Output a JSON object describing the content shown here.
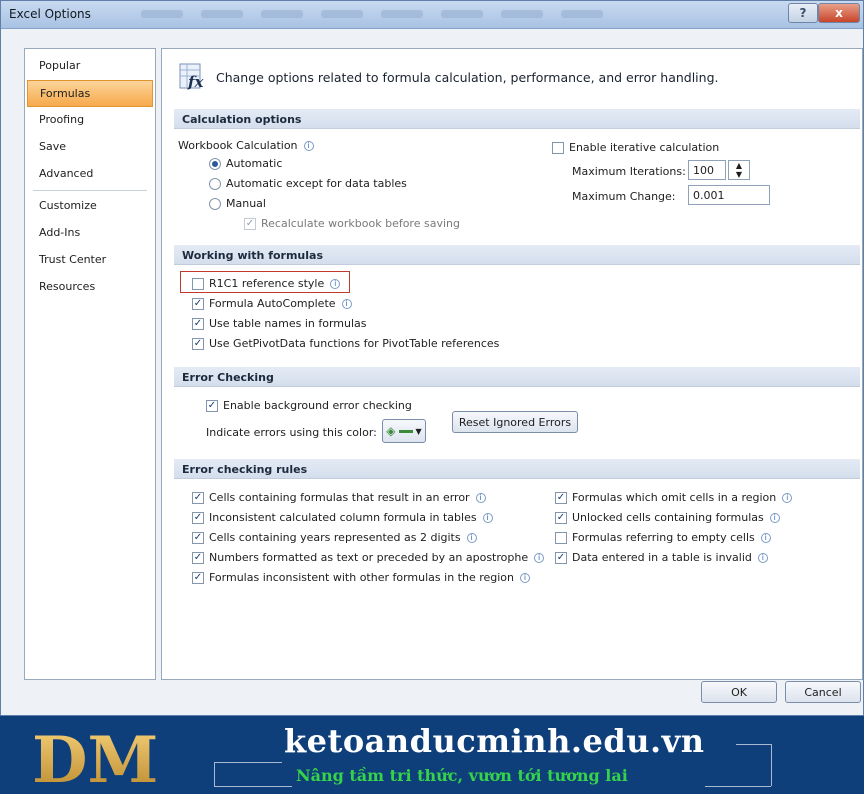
{
  "window": {
    "title": "Excel Options",
    "help": "?",
    "close": "x"
  },
  "sidebar": {
    "items": [
      "Popular",
      "Formulas",
      "Proofing",
      "Save",
      "Advanced",
      "Customize",
      "Add-Ins",
      "Trust Center",
      "Resources"
    ]
  },
  "header": {
    "text": "Change options related to formula calculation, performance, and error handling.",
    "icon": "fx"
  },
  "calc": {
    "section": "Calculation options",
    "workbook_label": "Workbook Calculation",
    "radio_auto": "Automatic",
    "radio_auto_except": "Automatic except for data tables",
    "radio_manual": "Manual",
    "recalc": "Recalculate workbook before saving",
    "iterative": "Enable iterative calculation",
    "max_iter_label": "Maximum Iterations:",
    "max_iter_value": "100",
    "max_change_label": "Maximum Change:",
    "max_change_value": "0.001"
  },
  "formulas": {
    "section": "Working with formulas",
    "r1c1": "R1C1 reference style",
    "autocomplete": "Formula AutoComplete",
    "table_names": "Use table names in formulas",
    "getpivot": "Use GetPivotData functions for PivotTable references"
  },
  "errcheck": {
    "section": "Error Checking",
    "enable_bg": "Enable background error checking",
    "indicate": "Indicate errors using this color:",
    "reset": "Reset Ignored Errors"
  },
  "rules": {
    "section": "Error checking rules",
    "left": [
      "Cells containing formulas that result in an error",
      "Inconsistent calculated column formula in tables",
      "Cells containing years represented as 2 digits",
      "Numbers formatted as text or preceded by an apostrophe",
      "Formulas inconsistent with other formulas in the region"
    ],
    "right": [
      "Formulas which omit cells in a region",
      "Unlocked cells containing formulas",
      "Formulas referring to empty cells",
      "Data entered in a table is invalid"
    ]
  },
  "buttons": {
    "ok": "OK",
    "cancel": "Cancel"
  },
  "footer": {
    "logo": "DM",
    "site": "ketoanducminh.edu.vn",
    "tagline": "Nâng tầm tri thức, vươn tới tương lai"
  },
  "colors": {
    "accent": "#f6a94b",
    "brand_bg": "#0f3f7a",
    "brand_green": "#35d24a",
    "highlight": "#c0392b"
  }
}
